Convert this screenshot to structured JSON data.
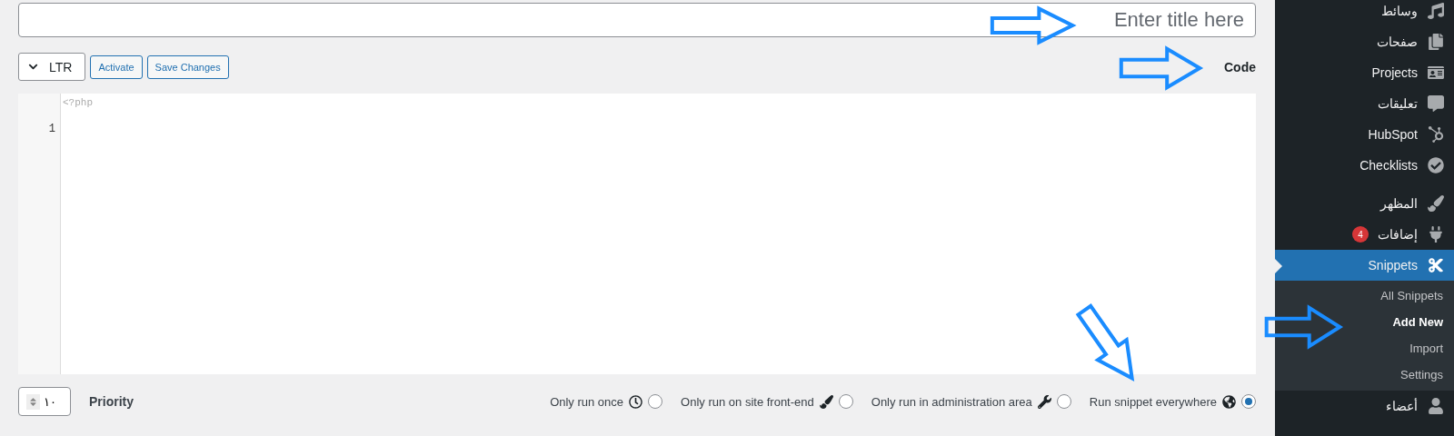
{
  "title_field": {
    "placeholder": "Enter title here"
  },
  "toolbar": {
    "direction": "LTR",
    "buttons": [
      "Activate",
      "Save Changes"
    ],
    "heading": "Code"
  },
  "editor": {
    "first_line": "<?php",
    "line_numbers": [
      "1"
    ]
  },
  "priority": {
    "value": "١٠",
    "label": "Priority"
  },
  "scopes": [
    {
      "kind": "once",
      "label": "Only run once",
      "selected": false
    },
    {
      "kind": "frontend",
      "label": "Only run on site front-end",
      "selected": false
    },
    {
      "kind": "admin",
      "label": "Only run in administration area",
      "selected": false
    },
    {
      "kind": "global",
      "label": "Run snippet everywhere",
      "selected": true
    }
  ],
  "sidebar": {
    "items": [
      {
        "kind": "media",
        "label": "وسائط",
        "selected": false
      },
      {
        "kind": "pages",
        "label": "صفحات",
        "selected": false
      },
      {
        "kind": "projects",
        "label": "Projects",
        "selected": false
      },
      {
        "kind": "comments",
        "label": "تعليقات",
        "selected": false
      },
      {
        "kind": "hubspot",
        "label": "HubSpot",
        "selected": false
      },
      {
        "kind": "checklists",
        "label": "Checklists",
        "selected": false
      },
      {
        "kind": "appearance",
        "label": "المظهر",
        "selected": false
      },
      {
        "kind": "plugins",
        "label": "إضافات",
        "badge": "4",
        "selected": false
      },
      {
        "kind": "snippets",
        "label": "Snippets",
        "selected": true,
        "children": [
          {
            "label": "All Snippets",
            "selected": false
          },
          {
            "label": "Add New",
            "selected": true
          },
          {
            "label": "Import",
            "selected": false
          },
          {
            "label": "Settings",
            "selected": false
          }
        ]
      },
      {
        "kind": "users",
        "label": "أعضاء",
        "selected": false
      }
    ]
  }
}
